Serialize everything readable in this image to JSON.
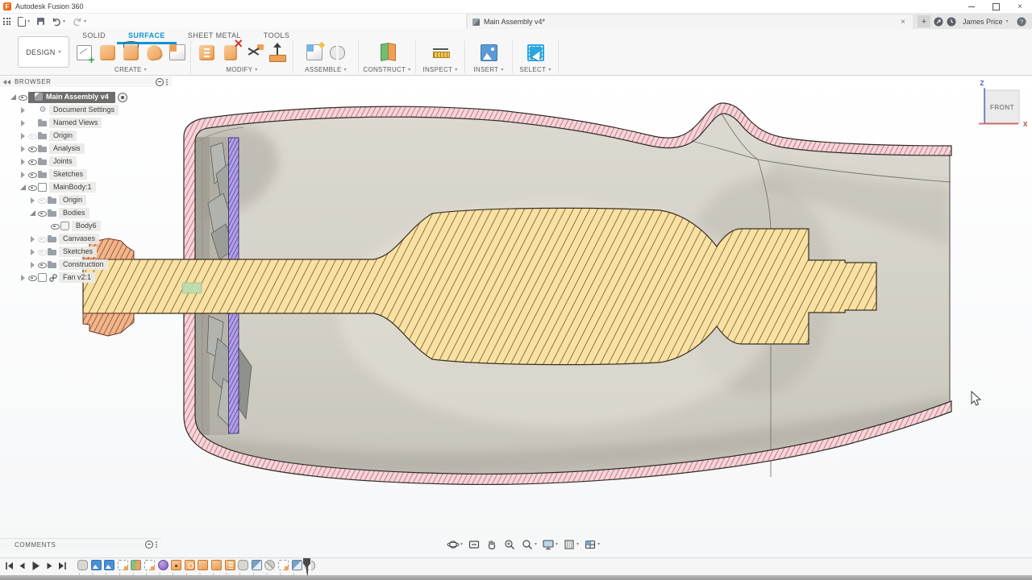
{
  "glyphs": {
    "caret": "▾",
    "close": "×",
    "plus": "+",
    "question": "?",
    "gear": "⚙"
  },
  "titlebar": {
    "app_title": "Autodesk Fusion 360"
  },
  "tabbar": {
    "document_title": "Main Assembly v4*",
    "user_name": "James Price"
  },
  "ribbon": {
    "design_label": "DESIGN",
    "tabs": [
      {
        "label": "SOLID"
      },
      {
        "label": "SURFACE"
      },
      {
        "label": "SHEET METAL"
      },
      {
        "label": "TOOLS"
      }
    ],
    "groups": [
      {
        "label": "CREATE"
      },
      {
        "label": "MODIFY"
      },
      {
        "label": "ASSEMBLE"
      },
      {
        "label": "CONSTRUCT"
      },
      {
        "label": "INSPECT"
      },
      {
        "label": "INSERT"
      },
      {
        "label": "SELECT"
      }
    ]
  },
  "browser": {
    "header": "BROWSER",
    "items": [
      {
        "label": "Main Assembly v4",
        "icon": "assembly",
        "selected": true
      },
      {
        "label": "Document Settings",
        "icon": "gear"
      },
      {
        "label": "Named Views",
        "icon": "folder"
      },
      {
        "label": "Origin",
        "icon": "folder"
      },
      {
        "label": "Analysis",
        "icon": "folder"
      },
      {
        "label": "Joints",
        "icon": "folder"
      },
      {
        "label": "Sketches",
        "icon": "folder"
      },
      {
        "label": "MainBody:1",
        "icon": "component"
      },
      {
        "label": "Origin",
        "icon": "folder"
      },
      {
        "label": "Bodies",
        "icon": "folder"
      },
      {
        "label": "Body6",
        "icon": "body"
      },
      {
        "label": "Canvases",
        "icon": "folder"
      },
      {
        "label": "Sketches",
        "icon": "folder"
      },
      {
        "label": "Construction",
        "icon": "folder"
      },
      {
        "label": "Fan v2:1",
        "icon": "component-linked"
      }
    ]
  },
  "comments": {
    "header": "COMMENTS"
  },
  "viewcube": {
    "face": "FRONT",
    "z_label": "Z",
    "x_label": "X"
  },
  "navbar": {
    "icons": [
      "orbit",
      "look-at",
      "pan",
      "zoom",
      "fit",
      "display-settings",
      "grid-settings",
      "viewports"
    ]
  },
  "timeline": {
    "playback": [
      "go-to-start",
      "step-back",
      "play",
      "step-forward",
      "go-to-end"
    ],
    "features": [
      "component",
      "canvas",
      "canvas",
      "sketch",
      "plane",
      "sketch",
      "form",
      "hole",
      "revolve",
      "extrude",
      "extrude",
      "rib",
      "patch",
      "component",
      "split",
      "sketch",
      "component",
      "joint"
    ]
  },
  "colors": {
    "accent": "#0a96d6",
    "hatch_pink_fill": "#f6d5da",
    "hatch_pink_line": "#b4636e",
    "hatch_yellow_fill": "#f9e1a3",
    "hatch_yellow_line": "#8a7440",
    "hatch_salmon_fill": "#f2b68c",
    "hatch_salmon_line": "#915137",
    "hatch_purple_fill": "#b2a0e8",
    "hatch_purple_line": "#56449a",
    "interior_top": "#dcd9d0",
    "interior_bottom": "#c8c5bb",
    "outline": "#2e2c27"
  }
}
